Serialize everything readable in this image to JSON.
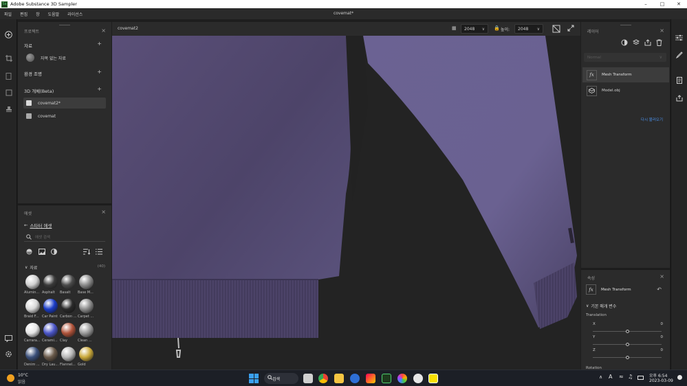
{
  "window": {
    "title": "Adobe Substance 3D Sampler",
    "document_title": "covemat*",
    "logo_text": "Sa"
  },
  "menu": [
    "파일",
    "편집",
    "창",
    "도움말",
    "라이선스"
  ],
  "project_panel": {
    "title": "프로젝트",
    "materials_title": "자료",
    "unnamed_material": "자목 없는 자료",
    "env_title": "환경 조명",
    "objects_title": "3D 개체(Beta)",
    "objects": [
      {
        "label": "covemat2*",
        "selected": true
      },
      {
        "label": "covemat",
        "selected": false
      }
    ]
  },
  "assets_panel": {
    "title": "에셋",
    "back_label": "스타터 에셋",
    "search_placeholder": "에셋 검색",
    "group_label": "자료",
    "group_count": "(40)",
    "materials": [
      {
        "label": "Alumin...",
        "color": "#cfcfcf"
      },
      {
        "label": "Asphalt",
        "color": "#3a3a3a"
      },
      {
        "label": "Basalt",
        "color": "#4a4a4a"
      },
      {
        "label": "Base M...",
        "color": "#8a8a8a"
      },
      {
        "label": "Braid F...",
        "color": "#d8d8d8"
      },
      {
        "label": "Car Paint",
        "color": "#1a3cc8"
      },
      {
        "label": "Carbon ...",
        "color": "#2a2a2a"
      },
      {
        "label": "Carpet ...",
        "color": "#8d8d8d"
      },
      {
        "label": "Carrara...",
        "color": "#e6e6e6"
      },
      {
        "label": "Cerami...",
        "color": "#4a55c8"
      },
      {
        "label": "Clay",
        "color": "#b0533a"
      },
      {
        "label": "Clean ...",
        "color": "#9a9a9a"
      },
      {
        "label": "Denim ...",
        "color": "#3a4f7a"
      },
      {
        "label": "Dry Lau...",
        "color": "#6a5a4a"
      },
      {
        "label": "Flannel...",
        "color": "#b8b8b8"
      },
      {
        "label": "Gold",
        "color": "#c9a83a"
      }
    ]
  },
  "viewport": {
    "tab_label": "covemat2",
    "width_value": "2048",
    "height_label": "높이:",
    "height_value": "2048"
  },
  "layers_panel": {
    "title": "레이어",
    "dropdown_placeholder": "Normal",
    "layers": [
      {
        "label": "Mesh Transform",
        "selected": true
      },
      {
        "label": "Model.obj",
        "selected": false
      }
    ],
    "reload_link": "다시 불러오기"
  },
  "properties_panel": {
    "title": "속성",
    "filter_name": "Mesh Transform",
    "section_title": "기본 매개 변수",
    "translation_label": "Translation",
    "axes": [
      {
        "name": "X",
        "value": "0",
        "level": 0.5
      },
      {
        "name": "Y",
        "value": "0",
        "level": 0.5
      },
      {
        "name": "Z",
        "value": "0",
        "level": 0.5
      }
    ],
    "rotation_label": "Rotation"
  },
  "taskbar": {
    "weather_temp": "10°C",
    "weather_desc": "맑음",
    "search_label": "검색",
    "time": "오후 6:54",
    "date": "2023-03-09",
    "ime": "A"
  }
}
